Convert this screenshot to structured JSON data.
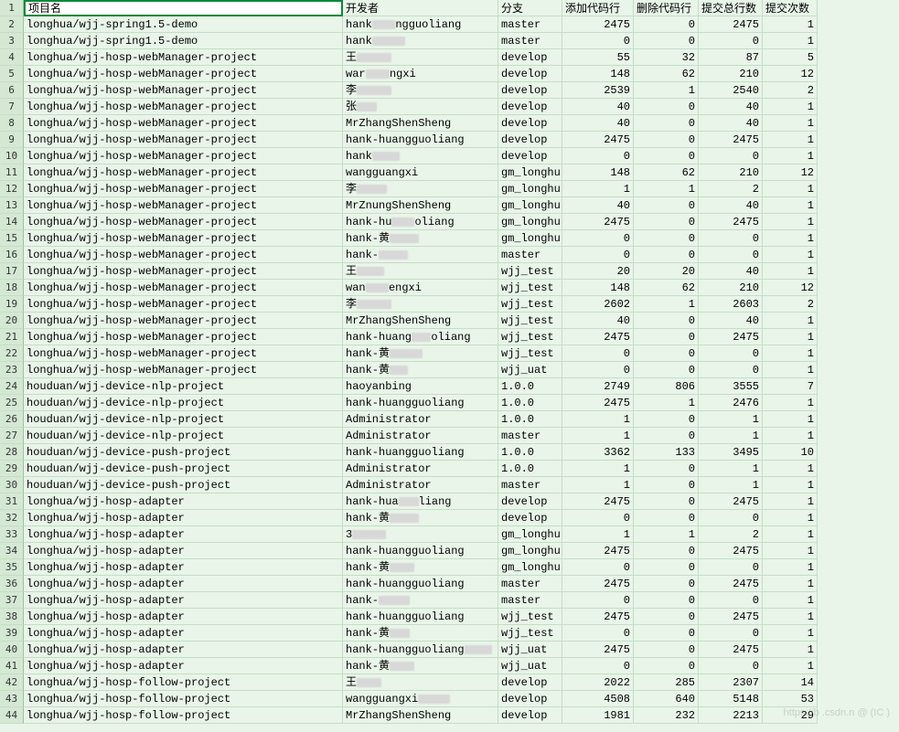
{
  "headers": {
    "project": "项目名",
    "developer": "开发者",
    "branch": "分支",
    "added": "添加代码行",
    "deleted": "删除代码行",
    "total": "提交总行数",
    "commits": "提交次数"
  },
  "rows": [
    {
      "n": 1,
      "project": "项目名",
      "dev": "开发者",
      "branch": "分支",
      "a": "添加代码行",
      "d": "删除代码行",
      "t": "提交总行数",
      "c": "提交次数",
      "hdr": true
    },
    {
      "n": 2,
      "project": "longhua/wjj-spring1.5-demo",
      "dev": "hank    ngguoliang",
      "branch": "master",
      "a": 2475,
      "d": 0,
      "t": 2475,
      "c": 1,
      "r": 1
    },
    {
      "n": 3,
      "project": "longhua/wjj-spring1.5-demo",
      "dev": "hank",
      "branch": "master",
      "a": 0,
      "d": 0,
      "t": 0,
      "c": 1,
      "r": 1
    },
    {
      "n": 4,
      "project": "longhua/wjj-hosp-webManager-project",
      "dev": "王",
      "branch": "develop",
      "a": 55,
      "d": 32,
      "t": 87,
      "c": 5,
      "r": 1
    },
    {
      "n": 5,
      "project": "longhua/wjj-hosp-webManager-project",
      "dev": "war      ngxi",
      "branch": "develop",
      "a": 148,
      "d": 62,
      "t": 210,
      "c": 12,
      "r": 1
    },
    {
      "n": 6,
      "project": "longhua/wjj-hosp-webManager-project",
      "dev": "李",
      "branch": "develop",
      "a": 2539,
      "d": 1,
      "t": 2540,
      "c": 2,
      "r": 1
    },
    {
      "n": 7,
      "project": "longhua/wjj-hosp-webManager-project",
      "dev": "张",
      "branch": "develop",
      "a": 40,
      "d": 0,
      "t": 40,
      "c": 1,
      "r": 1
    },
    {
      "n": 8,
      "project": "longhua/wjj-hosp-webManager-project",
      "dev": "MrZhangShenSheng",
      "branch": "develop",
      "a": 40,
      "d": 0,
      "t": 40,
      "c": 1
    },
    {
      "n": 9,
      "project": "longhua/wjj-hosp-webManager-project",
      "dev": "hank-huangguoliang",
      "branch": "develop",
      "a": 2475,
      "d": 0,
      "t": 2475,
      "c": 1
    },
    {
      "n": 10,
      "project": "longhua/wjj-hosp-webManager-project",
      "dev": "hank",
      "branch": "develop",
      "a": 0,
      "d": 0,
      "t": 0,
      "c": 1,
      "r": 1
    },
    {
      "n": 11,
      "project": "longhua/wjj-hosp-webManager-project",
      "dev": "wangguangxi",
      "branch": "gm_longhu",
      "a": 148,
      "d": 62,
      "t": 210,
      "c": 12
    },
    {
      "n": 12,
      "project": "longhua/wjj-hosp-webManager-project",
      "dev": "李",
      "branch": "gm_longhu",
      "a": 1,
      "d": 1,
      "t": 2,
      "c": 1,
      "r": 1
    },
    {
      "n": 13,
      "project": "longhua/wjj-hosp-webManager-project",
      "dev": "MrZnungShenSheng",
      "branch": "gm_longhu",
      "a": 40,
      "d": 0,
      "t": 40,
      "c": 1
    },
    {
      "n": 14,
      "project": "longhua/wjj-hosp-webManager-project",
      "dev": "hank-hu      oliang",
      "branch": "gm_longhu",
      "a": 2475,
      "d": 0,
      "t": 2475,
      "c": 1,
      "r": 1
    },
    {
      "n": 15,
      "project": "longhua/wjj-hosp-webManager-project",
      "dev": "hank-黄",
      "branch": "gm_longhu",
      "a": 0,
      "d": 0,
      "t": 0,
      "c": 1,
      "r": 1
    },
    {
      "n": 16,
      "project": "longhua/wjj-hosp-webManager-project",
      "dev": "hank-",
      "branch": "master",
      "a": 0,
      "d": 0,
      "t": 0,
      "c": 1,
      "r": 1
    },
    {
      "n": 17,
      "project": "longhua/wjj-hosp-webManager-project",
      "dev": "王",
      "branch": "wjj_test",
      "a": 20,
      "d": 20,
      "t": 40,
      "c": 1,
      "r": 1
    },
    {
      "n": 18,
      "project": "longhua/wjj-hosp-webManager-project",
      "dev": "wan   engxi",
      "branch": "wjj_test",
      "a": 148,
      "d": 62,
      "t": 210,
      "c": 12,
      "r": 1
    },
    {
      "n": 19,
      "project": "longhua/wjj-hosp-webManager-project",
      "dev": "李",
      "branch": "wjj_test",
      "a": 2602,
      "d": 1,
      "t": 2603,
      "c": 2,
      "r": 1
    },
    {
      "n": 20,
      "project": "longhua/wjj-hosp-webManager-project",
      "dev": "MrZhangShenSheng",
      "branch": "wjj_test",
      "a": 40,
      "d": 0,
      "t": 40,
      "c": 1
    },
    {
      "n": 21,
      "project": "longhua/wjj-hosp-webManager-project",
      "dev": "hank-huang  oliang",
      "branch": "wjj_test",
      "a": 2475,
      "d": 0,
      "t": 2475,
      "c": 1,
      "r": 1
    },
    {
      "n": 22,
      "project": "longhua/wjj-hosp-webManager-project",
      "dev": "hank-黄",
      "branch": "wjj_test",
      "a": 0,
      "d": 0,
      "t": 0,
      "c": 1,
      "r": 1
    },
    {
      "n": 23,
      "project": "longhua/wjj-hosp-webManager-project",
      "dev": "hank-黄",
      "branch": "wjj_uat",
      "a": 0,
      "d": 0,
      "t": 0,
      "c": 1,
      "r": 1
    },
    {
      "n": 24,
      "project": "houduan/wjj-device-nlp-project",
      "dev": "haoyanbing",
      "branch": "1.0.0",
      "a": 2749,
      "d": 806,
      "t": 3555,
      "c": 7
    },
    {
      "n": 25,
      "project": "houduan/wjj-device-nlp-project",
      "dev": "hank-huangguoliang",
      "branch": "1.0.0",
      "a": 2475,
      "d": 1,
      "t": 2476,
      "c": 1
    },
    {
      "n": 26,
      "project": "houduan/wjj-device-nlp-project",
      "dev": "Administrator",
      "branch": "1.0.0",
      "a": 1,
      "d": 0,
      "t": 1,
      "c": 1
    },
    {
      "n": 27,
      "project": "houduan/wjj-device-nlp-project",
      "dev": "Administrator",
      "branch": "master",
      "a": 1,
      "d": 0,
      "t": 1,
      "c": 1
    },
    {
      "n": 28,
      "project": "houduan/wjj-device-push-project",
      "dev": "hank-huangguoliang",
      "branch": "1.0.0",
      "a": 3362,
      "d": 133,
      "t": 3495,
      "c": 10
    },
    {
      "n": 29,
      "project": "houduan/wjj-device-push-project",
      "dev": "Administrator",
      "branch": "1.0.0",
      "a": 1,
      "d": 0,
      "t": 1,
      "c": 1
    },
    {
      "n": 30,
      "project": "houduan/wjj-device-push-project",
      "dev": "Administrator",
      "branch": "master",
      "a": 1,
      "d": 0,
      "t": 1,
      "c": 1
    },
    {
      "n": 31,
      "project": "longhua/wjj-hosp-adapter",
      "dev": "hank-hua    liang",
      "branch": "develop",
      "a": 2475,
      "d": 0,
      "t": 2475,
      "c": 1,
      "r": 1
    },
    {
      "n": 32,
      "project": "longhua/wjj-hosp-adapter",
      "dev": "hank-黄",
      "branch": "develop",
      "a": 0,
      "d": 0,
      "t": 0,
      "c": 1,
      "r": 1
    },
    {
      "n": 33,
      "project": "longhua/wjj-hosp-adapter",
      "dev": "3",
      "branch": "gm_longhu",
      "a": 1,
      "d": 1,
      "t": 2,
      "c": 1,
      "r": 1
    },
    {
      "n": 34,
      "project": "longhua/wjj-hosp-adapter",
      "dev": "hank-huangguoliang",
      "branch": "gm_longhu",
      "a": 2475,
      "d": 0,
      "t": 2475,
      "c": 1
    },
    {
      "n": 35,
      "project": "longhua/wjj-hosp-adapter",
      "dev": "hank-黄",
      "branch": "gm_longhu",
      "a": 0,
      "d": 0,
      "t": 0,
      "c": 1,
      "r": 1
    },
    {
      "n": 36,
      "project": "longhua/wjj-hosp-adapter",
      "dev": "hank-huangguoliang",
      "branch": "master",
      "a": 2475,
      "d": 0,
      "t": 2475,
      "c": 1
    },
    {
      "n": 37,
      "project": "longhua/wjj-hosp-adapter",
      "dev": "hank-",
      "branch": "master",
      "a": 0,
      "d": 0,
      "t": 0,
      "c": 1,
      "r": 1
    },
    {
      "n": 38,
      "project": "longhua/wjj-hosp-adapter",
      "dev": "hank-huangguoliang",
      "branch": "wjj_test",
      "a": 2475,
      "d": 0,
      "t": 2475,
      "c": 1
    },
    {
      "n": 39,
      "project": "longhua/wjj-hosp-adapter",
      "dev": "hank-黄",
      "branch": "wjj_test",
      "a": 0,
      "d": 0,
      "t": 0,
      "c": 1,
      "r": 1
    },
    {
      "n": 40,
      "project": "longhua/wjj-hosp-adapter",
      "dev": "hank-huangguoliang",
      "branch": "wjj_uat",
      "a": 2475,
      "d": 0,
      "t": 2475,
      "c": 1,
      "r": 1
    },
    {
      "n": 41,
      "project": "longhua/wjj-hosp-adapter",
      "dev": "hank-黄",
      "branch": "wjj_uat",
      "a": 0,
      "d": 0,
      "t": 0,
      "c": 1,
      "r": 1
    },
    {
      "n": 42,
      "project": "longhua/wjj-hosp-follow-project",
      "dev": "王",
      "branch": "develop",
      "a": 2022,
      "d": 285,
      "t": 2307,
      "c": 14,
      "r": 1
    },
    {
      "n": 43,
      "project": "longhua/wjj-hosp-follow-project",
      "dev": "wangguangxi",
      "branch": "develop",
      "a": 4508,
      "d": 640,
      "t": 5148,
      "c": 53,
      "r": 1
    },
    {
      "n": 44,
      "project": "longhua/wjj-hosp-follow-project",
      "dev": "MrZhangShenSheng",
      "branch": "develop",
      "a": 1981,
      "d": 232,
      "t": 2213,
      "c": 29
    }
  ],
  "watermark": "https://b .csdn.n @  (IC   )"
}
